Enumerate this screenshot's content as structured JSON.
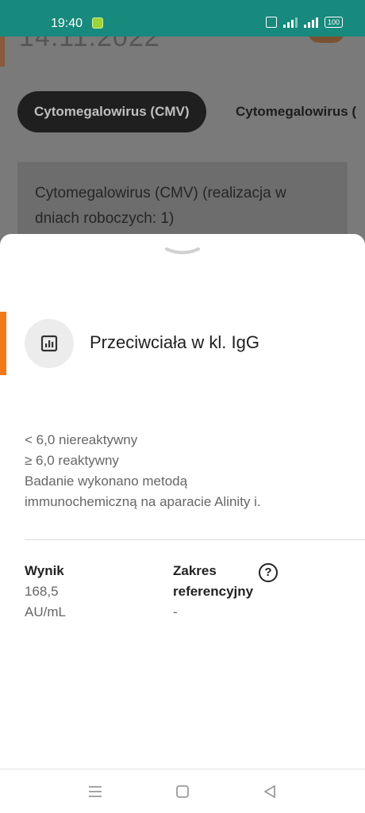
{
  "status_bar": {
    "time": "19:40",
    "battery": "100"
  },
  "background_page": {
    "date_partial": "14.11.2022",
    "tabs": [
      {
        "label": "Cytomegalowirus (CMV)",
        "active": true
      },
      {
        "label": "Cytomegalowirus (",
        "active": false
      }
    ],
    "card_text": "Cytomegalowirus (CMV) (realizacja w dniach roboczych: 1)"
  },
  "sheet": {
    "title": "Przeciwciała w kl. IgG",
    "icon": "chart-icon",
    "description_lines": [
      "< 6,0 niereaktywny",
      "≥ 6,0 reaktywny",
      "Badanie wykonano metodą",
      "immunochemiczną na aparacie Alinity i."
    ],
    "result": {
      "label": "Wynik",
      "value": "168,5",
      "unit": "AU/mL"
    },
    "reference": {
      "label_line1": "Zakres",
      "label_line2": "referencyjny",
      "value": "-",
      "help_symbol": "?"
    }
  },
  "colors": {
    "status_bar": "#17897d",
    "accent": "#f07a1a",
    "chip_active_bg": "#1f1f1f"
  },
  "nav_bar": {
    "icons": [
      "menu-icon",
      "home-icon",
      "back-icon"
    ]
  }
}
